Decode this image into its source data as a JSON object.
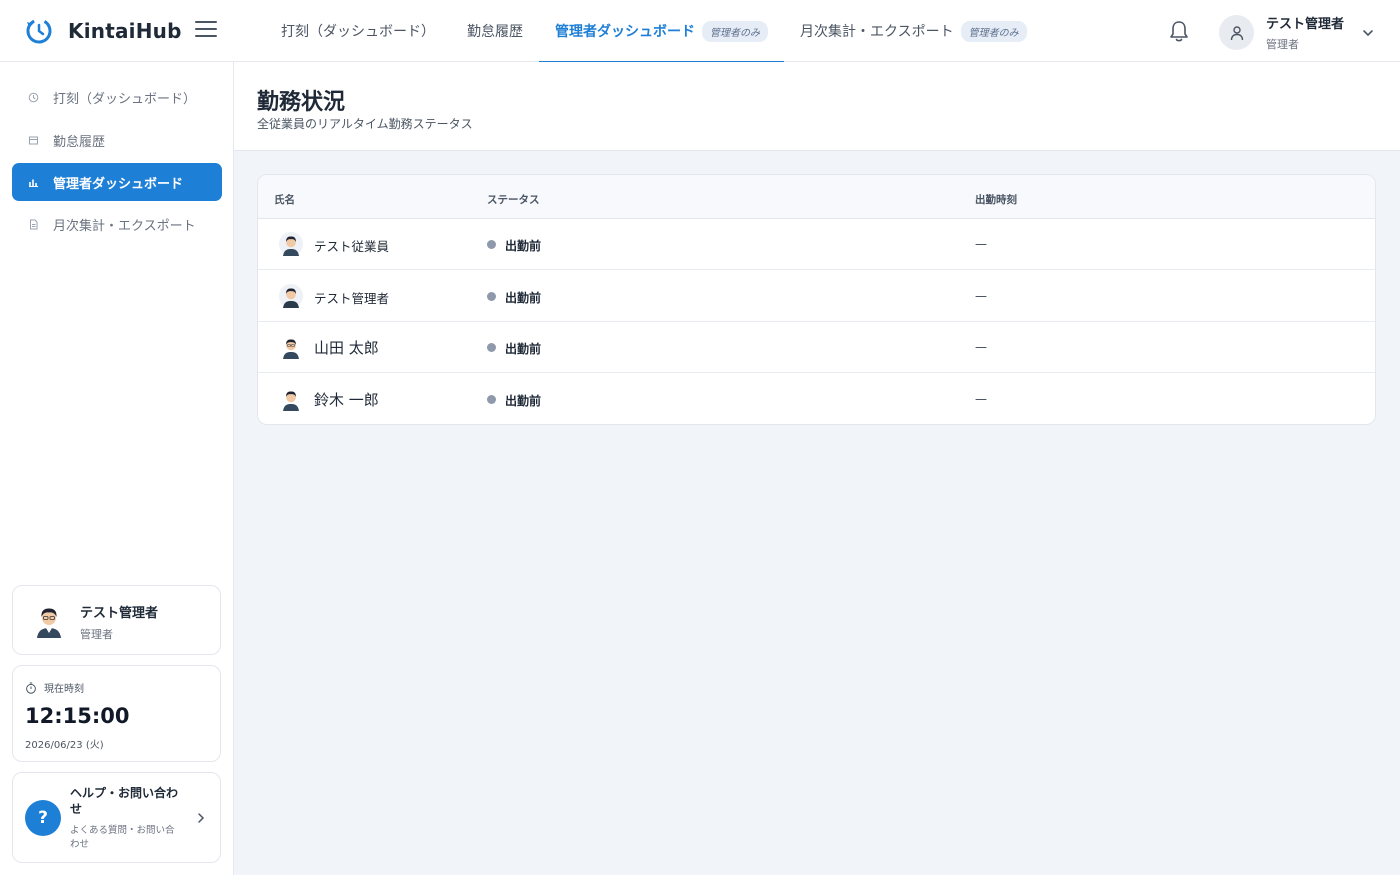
{
  "app": {
    "title": "KintaiHub"
  },
  "header": {
    "tabs": [
      {
        "label": "打刻（ダッシュボード）",
        "badge": ""
      },
      {
        "label": "勤怠履歴",
        "badge": ""
      },
      {
        "label": "管理者ダッシュボード",
        "badge": "管理者のみ"
      },
      {
        "label": "月次集計・エクスポート",
        "badge": "管理者のみ"
      }
    ],
    "user": {
      "name": "テスト管理者",
      "role": "管理者"
    }
  },
  "sidebar": {
    "items": [
      {
        "label": "打刻（ダッシュボード）",
        "icon": "clock-icon"
      },
      {
        "label": "勤怠履歴",
        "icon": "calendar-icon"
      },
      {
        "label": "管理者ダッシュボード",
        "icon": "bar-chart-icon"
      },
      {
        "label": "月次集計・エクスポート",
        "icon": "document-icon"
      }
    ],
    "profile": {
      "name": "テスト管理者",
      "role": "管理者"
    },
    "clock": {
      "label": "現在時刻",
      "time": "12:15:00",
      "date": "2026/06/23 (火)"
    },
    "help": {
      "title": "ヘルプ・お問い合わせ",
      "subtitle": "よくある質問・お問い合わせ",
      "icon_text": "?"
    }
  },
  "main": {
    "title": "勤務状況",
    "subtitle": "全従業員のリアルタイム勤務ステータス",
    "table": {
      "columns": [
        "氏名",
        "ステータス",
        "出勤時刻"
      ],
      "rows": [
        {
          "name": "テスト従業員",
          "status": "出勤前",
          "clock_in": "—"
        },
        {
          "name": "テスト管理者",
          "status": "出勤前",
          "clock_in": "—"
        },
        {
          "name": "山田 太郎",
          "status": "出勤前",
          "clock_in": "—"
        },
        {
          "name": "鈴木 一郎",
          "status": "出勤前",
          "clock_in": "—"
        }
      ]
    }
  },
  "colors": {
    "accent": "#1e7fd6",
    "status_dot": "#8e99ac",
    "badge_bg": "#e7edf6"
  }
}
